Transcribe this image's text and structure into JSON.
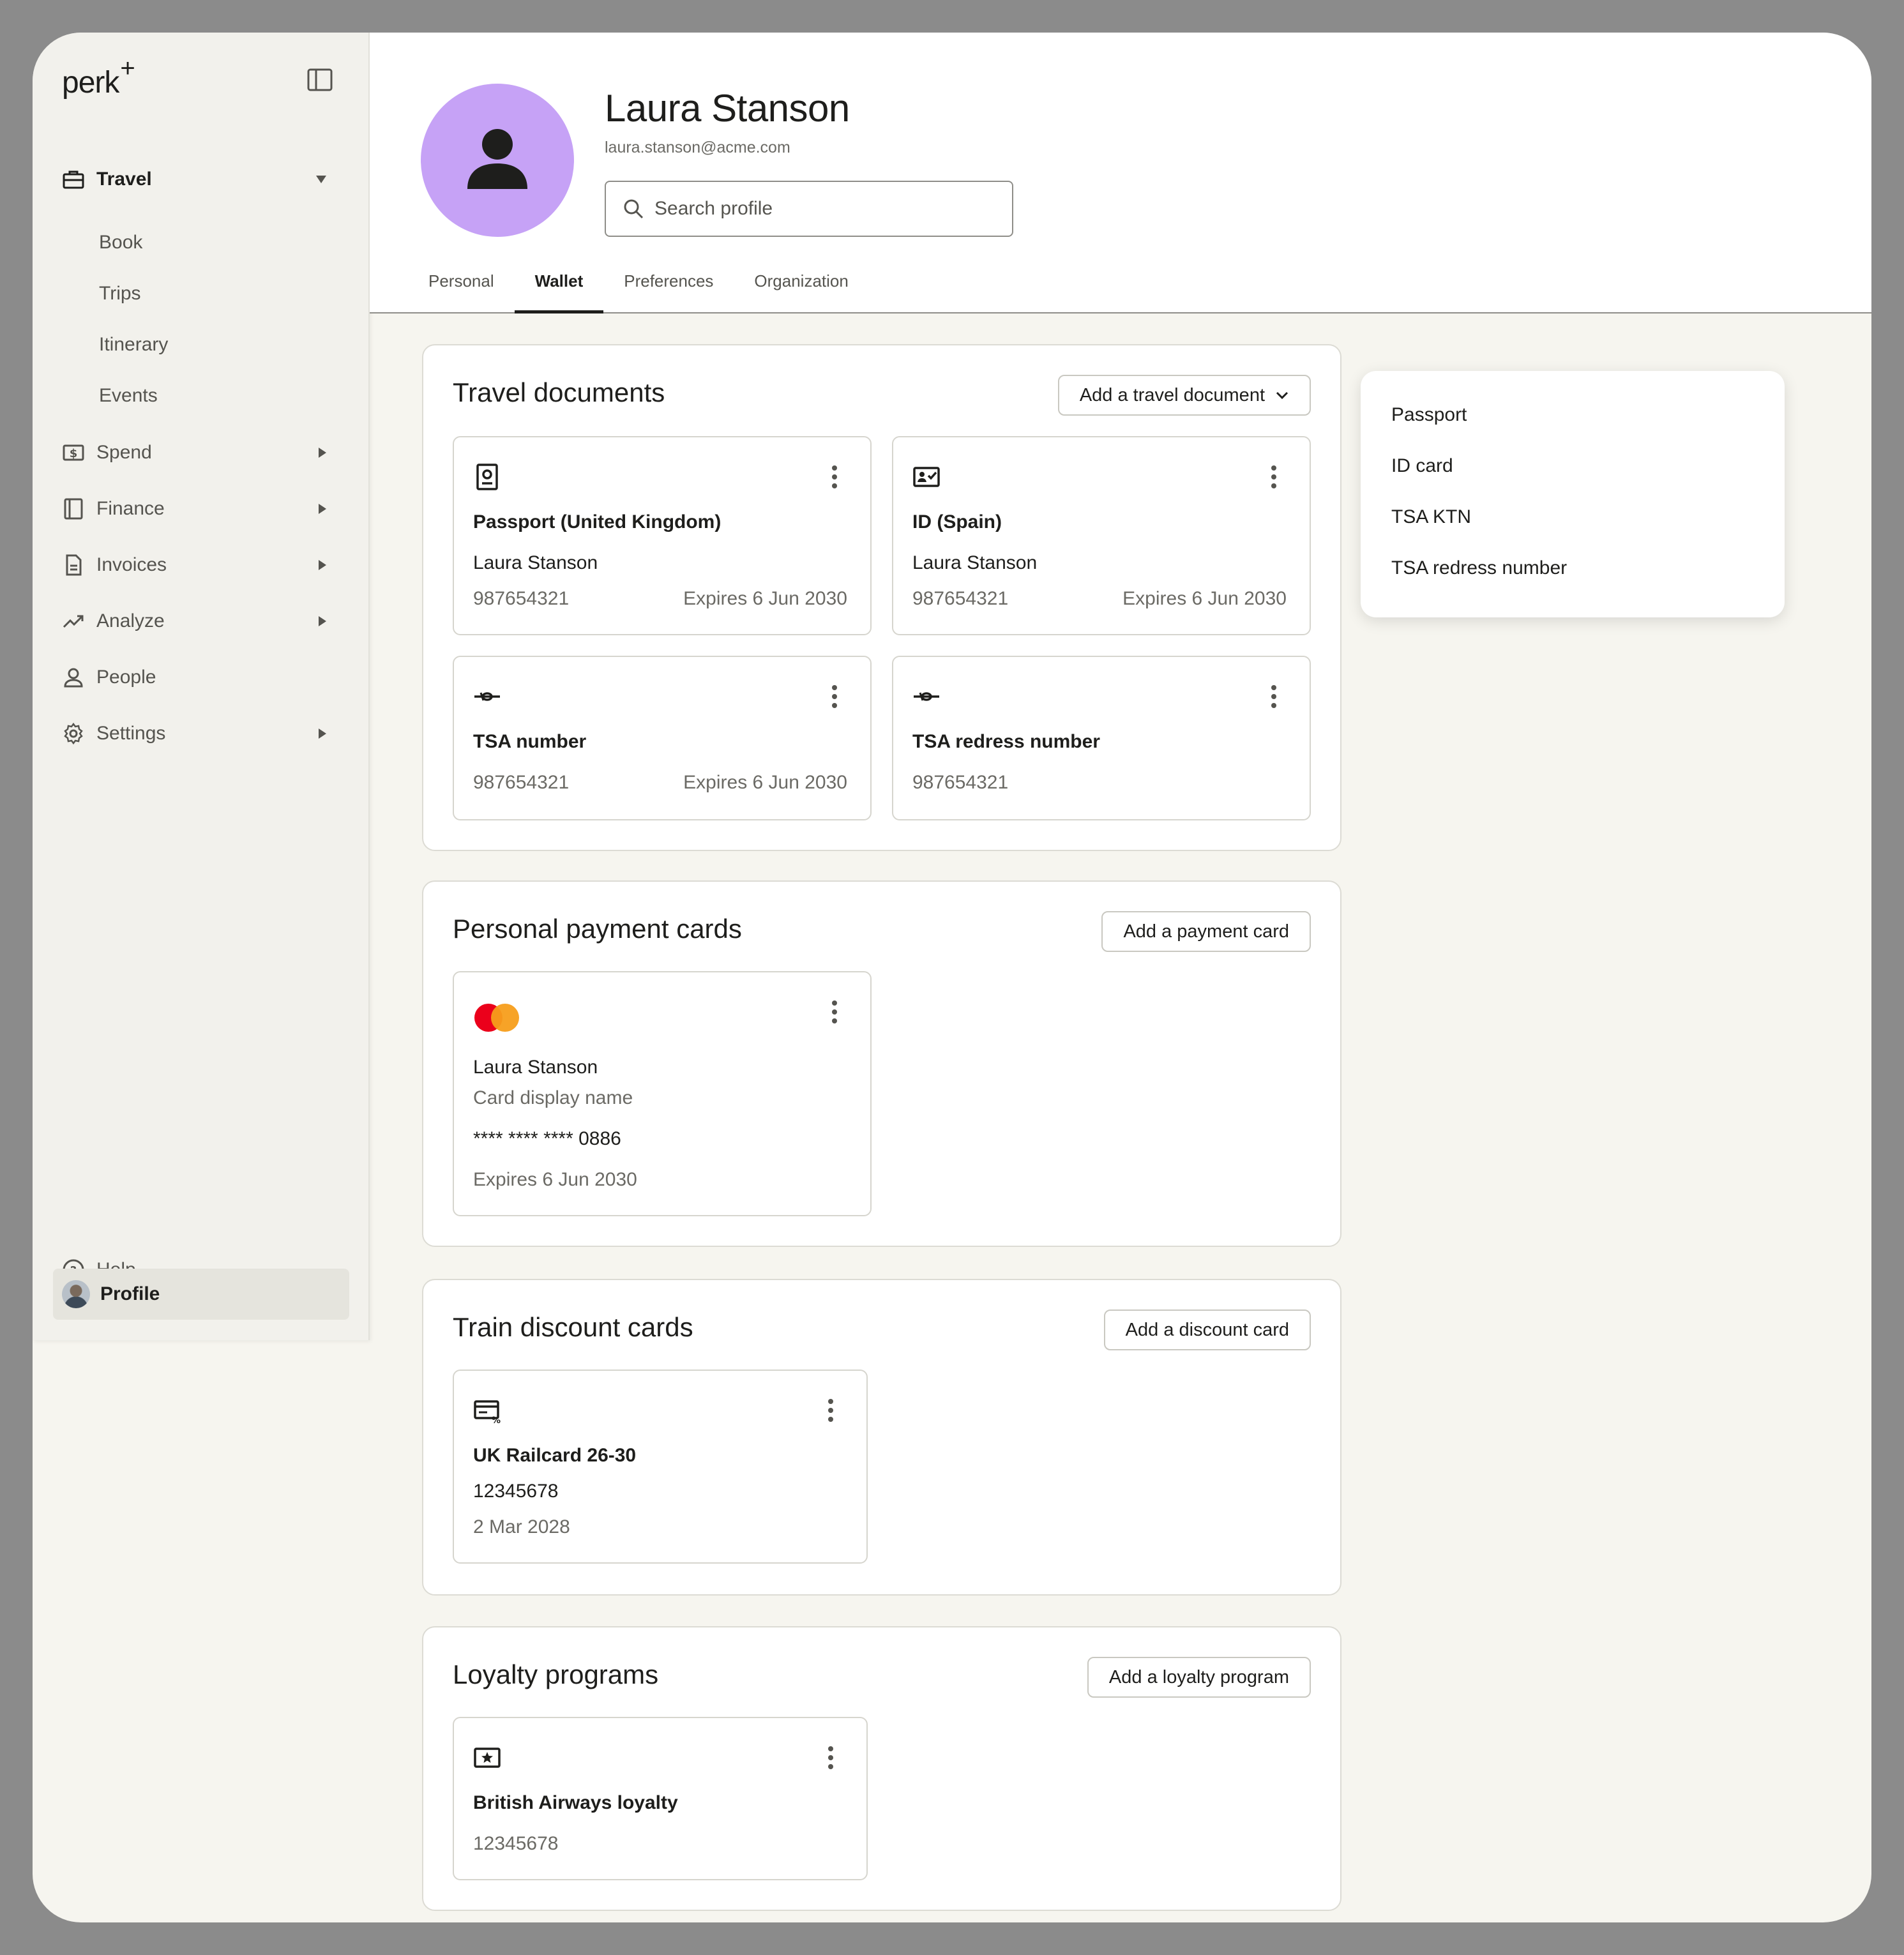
{
  "app": {
    "logo": "perk"
  },
  "sidebar": {
    "travel": {
      "label": "Travel",
      "subitems": [
        "Book",
        "Trips",
        "Itinerary",
        "Events"
      ]
    },
    "items": [
      {
        "label": "Spend",
        "icon": "dollar-icon"
      },
      {
        "label": "Finance",
        "icon": "ledger-icon"
      },
      {
        "label": "Invoices",
        "icon": "document-icon"
      },
      {
        "label": "Analyze",
        "icon": "trend-icon"
      },
      {
        "label": "People",
        "icon": "person-icon"
      },
      {
        "label": "Settings",
        "icon": "gear-icon"
      }
    ],
    "help": "Help",
    "profile": "Profile"
  },
  "header": {
    "name": "Laura Stanson",
    "email": "laura.stanson@acme.com",
    "search_placeholder": "Search profile",
    "tabs": [
      "Personal",
      "Wallet",
      "Preferences",
      "Organization"
    ],
    "active_tab": "Wallet"
  },
  "travel_documents": {
    "title": "Travel documents",
    "add_label": "Add a travel document",
    "cards": [
      {
        "title": "Passport (United Kingdom)",
        "holder": "Laura Stanson",
        "number": "987654321",
        "expires": "Expires 6 Jun 2030"
      },
      {
        "title": "ID (Spain)",
        "holder": "Laura Stanson",
        "number": "987654321",
        "expires": "Expires 6 Jun 2030"
      },
      {
        "title": "TSA number",
        "number": "987654321",
        "expires": "Expires 6 Jun 2030"
      },
      {
        "title": "TSA redress number",
        "number": "987654321"
      }
    ]
  },
  "payment_cards": {
    "title": "Personal payment cards",
    "add_label": "Add a payment card",
    "card": {
      "holder": "Laura Stanson",
      "display_name": "Card display name",
      "number": "**** **** **** 0886",
      "expires": "Expires 6 Jun 2030"
    }
  },
  "discount_cards": {
    "title": "Train discount cards",
    "add_label": "Add a discount card",
    "card": {
      "name": "UK Railcard 26-30",
      "number": "12345678",
      "date": "2 Mar 2028"
    }
  },
  "loyalty": {
    "title": "Loyalty programs",
    "add_label": "Add a loyalty program",
    "card": {
      "name": "British Airways loyalty",
      "number": "12345678"
    }
  },
  "dropdown": {
    "options": [
      "Passport",
      "ID card",
      "TSA KTN",
      "TSA redress number"
    ]
  },
  "colors": {
    "avatar": "#c6a2f6",
    "mastercard_red": "#eb001b",
    "mastercard_orange": "#f79e1b"
  }
}
